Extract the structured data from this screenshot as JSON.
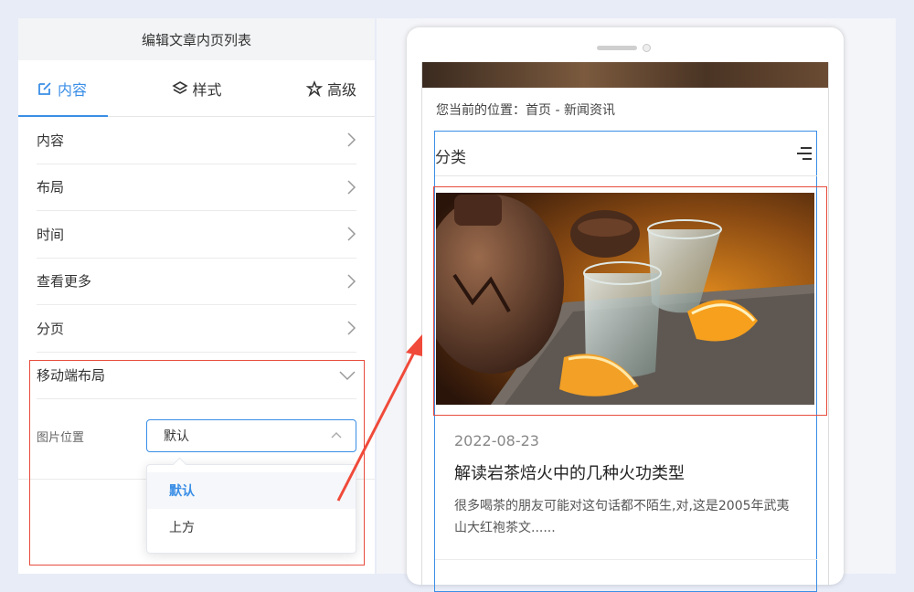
{
  "panel": {
    "title": "编辑文章内页列表",
    "tabs": [
      {
        "label": "内容",
        "icon": "edit-icon",
        "active": true
      },
      {
        "label": "样式",
        "icon": "layers-icon",
        "active": false
      },
      {
        "label": "高级",
        "icon": "star-outline-icon",
        "active": false
      }
    ],
    "menu": [
      {
        "label": "内容"
      },
      {
        "label": "布局"
      },
      {
        "label": "时间"
      },
      {
        "label": "查看更多"
      },
      {
        "label": "分页"
      }
    ],
    "mobile_layout": {
      "label": "移动端布局",
      "image_position_label": "图片位置",
      "selected": "默认",
      "options": [
        "默认",
        "上方"
      ]
    }
  },
  "preview": {
    "breadcrumb": "您当前的位置：首页 - 新闻资讯",
    "category_title": "分类",
    "article": {
      "date": "2022-08-23",
      "title": "解读岩茶焙火中的几种火功类型",
      "excerpt": "很多喝茶的朋友可能对这句话都不陌生,对,这是2005年武夷山大红袍茶文......"
    }
  },
  "colors": {
    "accent": "#3a8ee6",
    "highlight_red": "#e74c3c",
    "background": "#e8ecf7"
  }
}
